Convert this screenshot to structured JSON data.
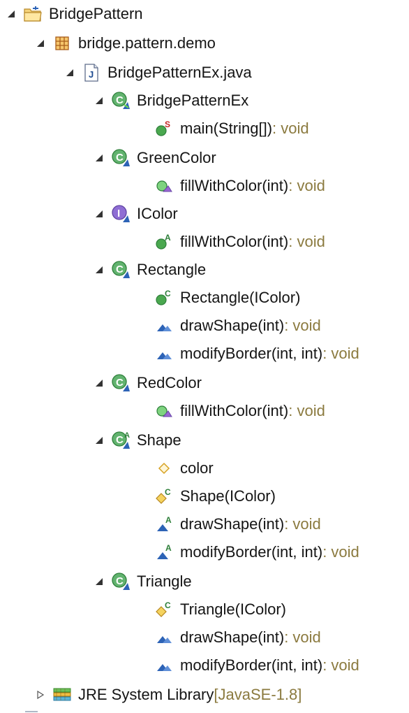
{
  "tree": {
    "project": {
      "label": "BridgePattern"
    },
    "package": {
      "label": "bridge.pattern.demo"
    },
    "file": {
      "label": "BridgePatternEx.java"
    },
    "classes": [
      {
        "label": "BridgePatternEx",
        "members": [
          {
            "label": "main(String[])",
            "suffix": " : void"
          }
        ]
      },
      {
        "label": "GreenColor",
        "members": [
          {
            "label": "fillWithColor(int)",
            "suffix": " : void"
          }
        ]
      },
      {
        "label": "IColor",
        "members": [
          {
            "label": "fillWithColor(int)",
            "suffix": " : void"
          }
        ]
      },
      {
        "label": "Rectangle",
        "members": [
          {
            "label": "Rectangle(IColor)",
            "suffix": ""
          },
          {
            "label": "drawShape(int)",
            "suffix": " : void"
          },
          {
            "label": "modifyBorder(int, int)",
            "suffix": " : void"
          }
        ]
      },
      {
        "label": "RedColor",
        "members": [
          {
            "label": "fillWithColor(int)",
            "suffix": " : void"
          }
        ]
      },
      {
        "label": "Shape",
        "members": [
          {
            "label": "color",
            "suffix": ""
          },
          {
            "label": "Shape(IColor)",
            "suffix": ""
          },
          {
            "label": "drawShape(int)",
            "suffix": " : void"
          },
          {
            "label": "modifyBorder(int, int)",
            "suffix": " : void"
          }
        ]
      },
      {
        "label": "Triangle",
        "members": [
          {
            "label": "Triangle(IColor)",
            "suffix": ""
          },
          {
            "label": "drawShape(int)",
            "suffix": " : void"
          },
          {
            "label": "modifyBorder(int, int)",
            "suffix": " : void"
          }
        ]
      }
    ],
    "library": {
      "label": "JRE System Library",
      "suffix": " [JavaSE-1.8]"
    }
  },
  "icons": {
    "expanded_twisty": "expanded-triangle-icon",
    "collapsed_twisty": "collapsed-triangle-icon",
    "project": "project-folder-icon",
    "package": "package-icon",
    "java_file": "java-file-icon",
    "class": "public-class-icon",
    "interface": "interface-icon",
    "abstract_class": "abstract-class-icon",
    "method_public": "public-method-icon",
    "method_default": "default-method-icon",
    "field": "field-icon",
    "library": "library-icon"
  },
  "colors": {
    "suffix": "#8b7a3f",
    "label": "#151515",
    "class_green": "#2f8f3a",
    "interface_purple": "#6a4aa8",
    "package_orange": "#c9611f"
  }
}
